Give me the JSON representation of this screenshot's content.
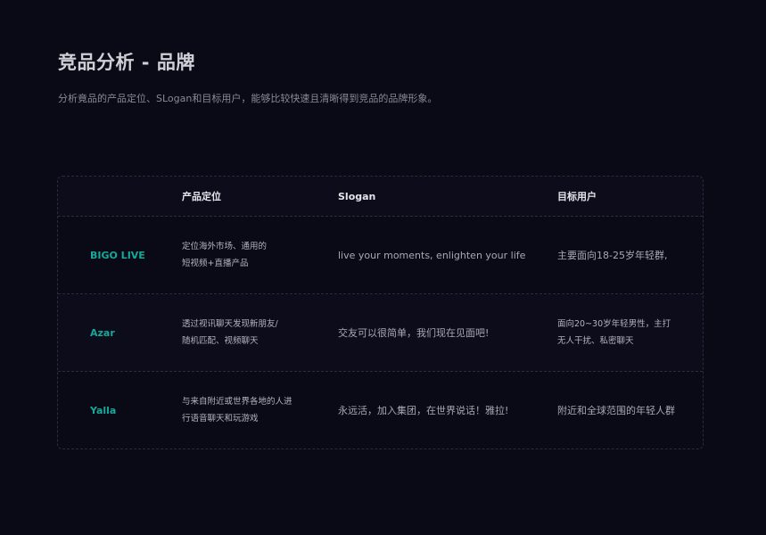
{
  "header": {
    "title": "竞品分析 - 品牌",
    "subtitle": "分析竟品的产品定位、SLogan和目标用户，能够比较快速且清晰得到竞品的品牌形象。"
  },
  "table": {
    "columns": [
      "",
      "产品定位",
      "Slogan",
      "目标用户"
    ],
    "rows": [
      {
        "brand": "BIGO LIVE",
        "positioning": [
          "定位海外市场、通用的",
          "短视频+直播产品"
        ],
        "slogan": "live your moments, enlighten your life",
        "target": [
          "主要面向18-25岁年轻群,"
        ]
      },
      {
        "brand": "Azar",
        "positioning": [
          "透过视讯聊天发现新朋友/",
          "随机匹配、视频聊天"
        ],
        "slogan": "交友可以很简单，我们现在见面吧!",
        "target": [
          "面向20~30岁年轻男性，主打",
          "无人干扰、私密聊天"
        ]
      },
      {
        "brand": "Yalla",
        "positioning": [
          "与来自附近或世界各地的人进",
          "行语音聊天和玩游戏"
        ],
        "slogan": "永远活，加入集团，在世界说话！雅拉!",
        "target": [
          "附近和全球范围的年轻人群"
        ]
      }
    ]
  },
  "colors": {
    "background": "#0a0916",
    "brand_accent": "#17a89a"
  }
}
